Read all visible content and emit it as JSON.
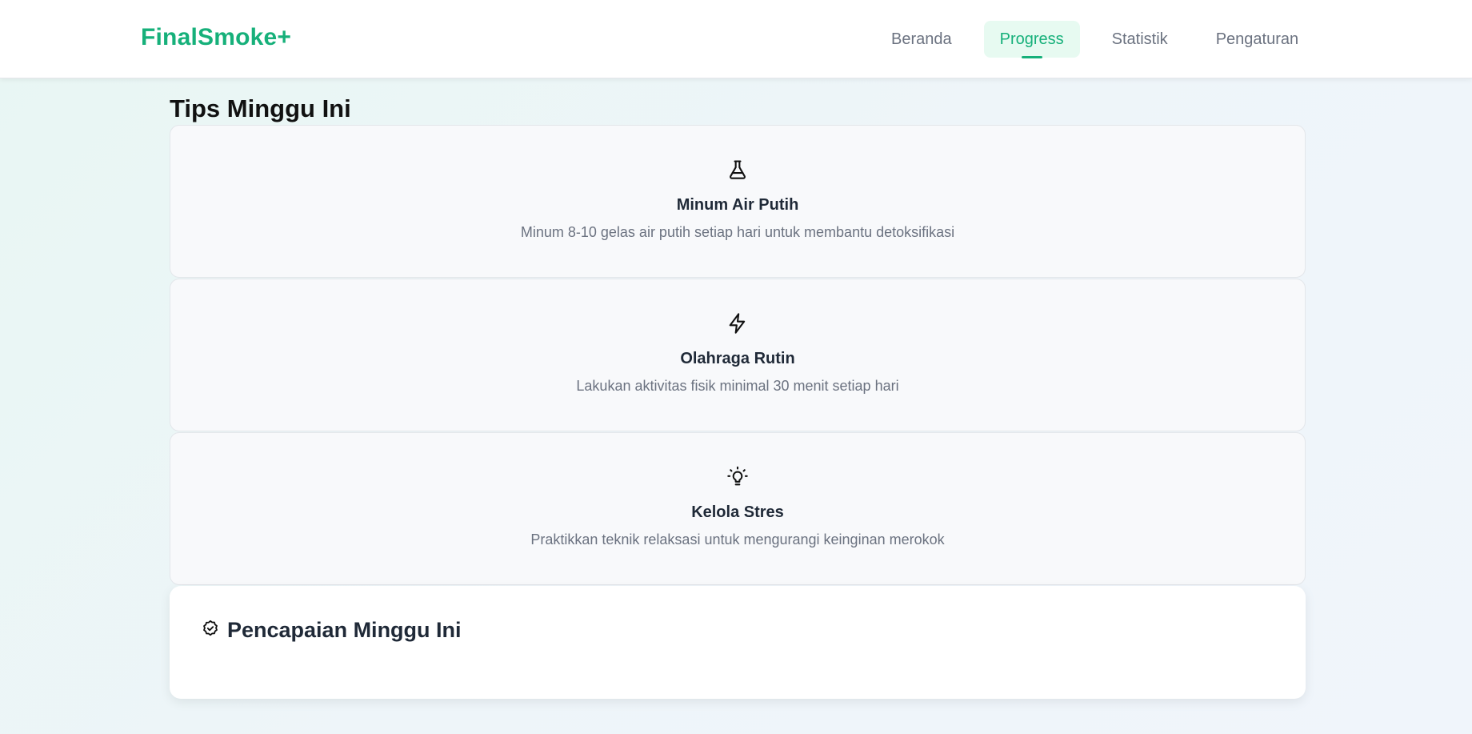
{
  "header": {
    "logo": "FinalSmoke+",
    "nav": [
      {
        "label": "Beranda",
        "active": false
      },
      {
        "label": "Progress",
        "active": true
      },
      {
        "label": "Statistik",
        "active": false
      },
      {
        "label": "Pengaturan",
        "active": false
      }
    ]
  },
  "main": {
    "tips_title": "Tips Minggu Ini",
    "tips": [
      {
        "icon": "flask-icon",
        "title": "Minum Air Putih",
        "description": "Minum 8-10 gelas air putih setiap hari untuk membantu detoksifikasi"
      },
      {
        "icon": "lightning-icon",
        "title": "Olahraga Rutin",
        "description": "Lakukan aktivitas fisik minimal 30 menit setiap hari"
      },
      {
        "icon": "lightbulb-icon",
        "title": "Kelola Stres",
        "description": "Praktikkan teknik relaksasi untuk mengurangi keinginan merokok"
      }
    ],
    "achievement": {
      "icon": "badge-check-icon",
      "title": "Pencapaian Minggu Ini"
    }
  },
  "colors": {
    "brand": "#16b07a",
    "nav_active_bg": "#e7faf1",
    "muted_text": "#6b7280"
  }
}
